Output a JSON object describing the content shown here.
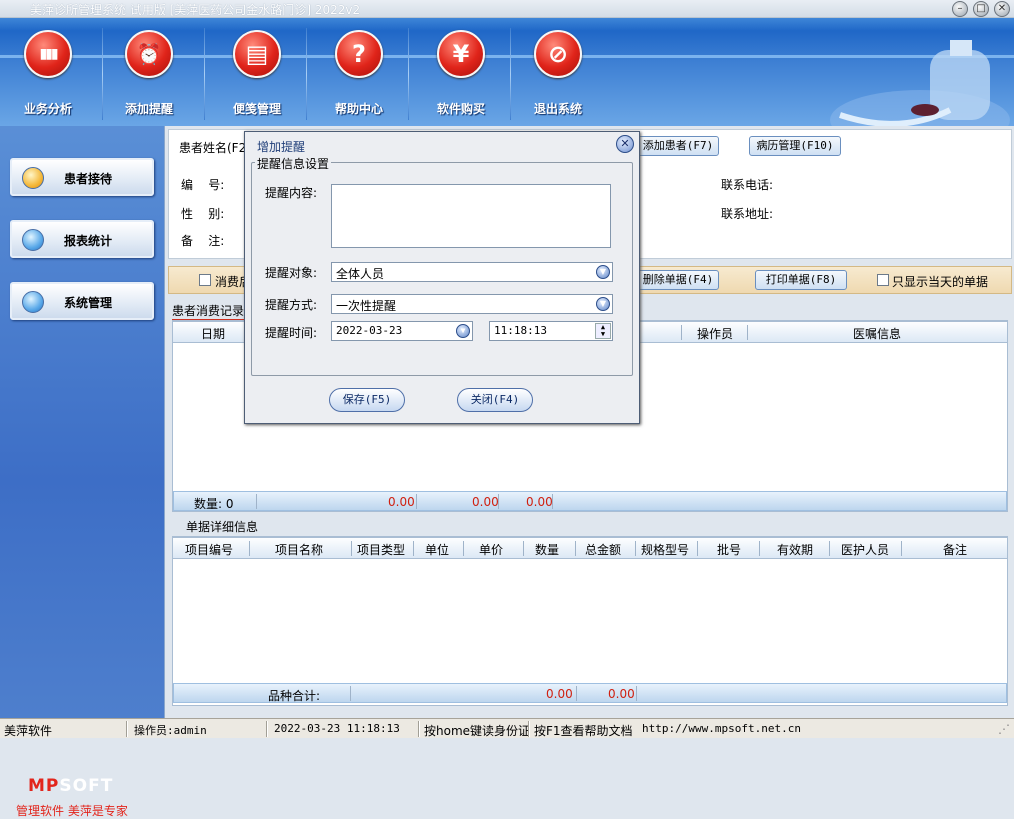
{
  "window": {
    "title": "美萍诊所管理系统 试用版 [美萍医药公司金水路门诊] 2022v2"
  },
  "toolbar": [
    {
      "label": "业务分析",
      "icon": "bar-chart-icon",
      "glyph": "▮▮▮"
    },
    {
      "label": "添加提醒",
      "icon": "clock-icon",
      "glyph": "⏰"
    },
    {
      "label": "便笺管理",
      "icon": "notepad-icon",
      "glyph": "▤"
    },
    {
      "label": "帮助中心",
      "icon": "question-icon",
      "glyph": "?"
    },
    {
      "label": "软件购买",
      "icon": "yen-icon",
      "glyph": "¥"
    },
    {
      "label": "退出系统",
      "icon": "exit-icon",
      "glyph": "⊘"
    }
  ],
  "sidebar": {
    "items": [
      {
        "label": "患者接待",
        "active": true
      },
      {
        "label": "报表统计",
        "active": false
      },
      {
        "label": "系统管理",
        "active": false
      }
    ],
    "logo_part1": "MP",
    "logo_part2": "SOFT",
    "slogan": "管理软件  美萍是专家"
  },
  "patient": {
    "name_label": "患者姓名(F2",
    "add_patient_button": "添加患者(F7)",
    "records_button": "病历管理(F10)",
    "id_label": "编    号:",
    "gender_label": "性    别:",
    "note_label": "备    注:",
    "phone_label": "联系电话:",
    "address_label": "联系地址:"
  },
  "consumption": {
    "after_checkbox": "消费后",
    "delete_button": "删除单据(F4)",
    "print_button": "打印单据(F8)",
    "today_only_checkbox": "只显示当天的单据",
    "tab_label": "患者消费记录",
    "columns": [
      "日期",
      "操作员",
      "医嘱信息"
    ],
    "count_label": "数量: 0",
    "totals": [
      "0.00",
      "0.00",
      "0.00"
    ]
  },
  "detail": {
    "section_label": "单据详细信息",
    "columns": [
      "项目编号",
      "项目名称",
      "项目类型",
      "单位",
      "单价",
      "数量",
      "总金额",
      "规格型号",
      "批号",
      "有效期",
      "医护人员",
      "备注"
    ],
    "variety_total_label": "品种合计:",
    "totals": [
      "0.00",
      "0.00"
    ]
  },
  "dialog": {
    "title": "增加提醒",
    "legend": "提醒信息设置",
    "content_label": "提醒内容:",
    "content_value": "",
    "target_label": "提醒对象:",
    "target_value": "全体人员",
    "method_label": "提醒方式:",
    "method_value": "一次性提醒",
    "time_label": "提醒时间:",
    "date_value": "2022-03-23",
    "time_value": "11:18:13",
    "save_button": "保存(F5)",
    "close_button": "关闭(F4)"
  },
  "statusbar": {
    "app": "美萍软件",
    "operator": "操作员:admin",
    "datetime": "2022-03-23 11:18:13",
    "id_card_hint": "按home键读身份证",
    "help_hint": "按F1查看帮助文档",
    "url": "http://www.mpsoft.net.cn"
  }
}
